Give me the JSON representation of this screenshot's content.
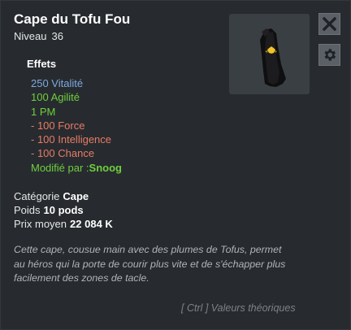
{
  "item": {
    "name": "Cape du Tofu Fou",
    "level_label": "Niveau",
    "level_value": "36"
  },
  "buttons": {
    "close_icon": "close-icon",
    "settings_icon": "gear-icon"
  },
  "effects": {
    "title": "Effets",
    "lines": [
      {
        "text": "250 Vitalité",
        "color": "#7fa9df"
      },
      {
        "text": "100 Agilité",
        "color": "#6fcf3e"
      },
      {
        "text": "1 PM",
        "color": "#6fcf3e"
      },
      {
        "text": "- 100 Force",
        "color": "#e87b66"
      },
      {
        "text": "- 100 Intelligence",
        "color": "#e87b66"
      },
      {
        "text": "- 100 Chance",
        "color": "#e87b66"
      }
    ],
    "modified_label": "Modifié par :",
    "modified_by": "Snoog"
  },
  "info": {
    "category_label": "Catégorie",
    "category_value": "Cape",
    "weight_label": "Poids",
    "weight_value": "10 pods",
    "price_label": "Prix moyen",
    "price_value": "22 084 K"
  },
  "description": "Cette cape, cousue main avec des plumes de Tofus, permet au héros qui la porte de courir plus vite et de s'échapper plus facilement des zones de tacle.",
  "hint": "[ Ctrl ] Valeurs théoriques"
}
